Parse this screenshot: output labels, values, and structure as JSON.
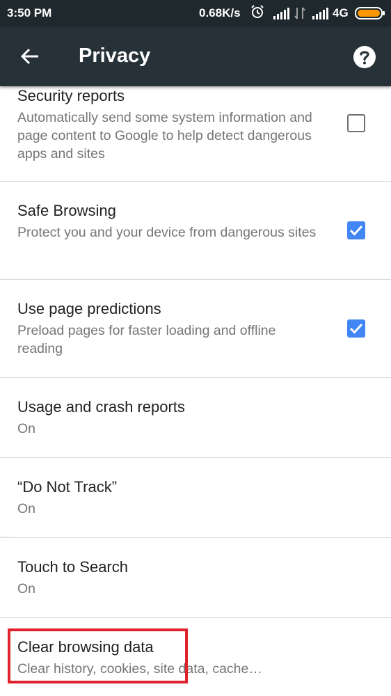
{
  "status_bar": {
    "time": "3:50 PM",
    "speed": "0.68K/s",
    "network": "4G",
    "icons": [
      "alarm-icon",
      "signal-icon",
      "data-transfer-icon",
      "signal-icon",
      "battery-icon"
    ],
    "battery_color": "#ff9800"
  },
  "app_bar": {
    "title": "Privacy",
    "back_icon": "arrow-back-icon",
    "help_icon": "help-circle-icon",
    "background": "#263238"
  },
  "settings": [
    {
      "title": "Security reports",
      "summary": "Automatically send some system information and page content to Google to help detect dangerous apps and sites",
      "checkbox": false
    },
    {
      "title": "Safe Browsing",
      "summary": "Protect you and your device from dangerous sites",
      "checkbox": true
    },
    {
      "title": "Use page predictions",
      "summary": "Preload pages for faster loading and offline reading",
      "checkbox": true
    },
    {
      "title": "Usage and crash reports",
      "summary": "On"
    },
    {
      "title": "“Do Not Track”",
      "summary": "On"
    },
    {
      "title": "Touch to Search",
      "summary": "On"
    },
    {
      "title": "Clear browsing data",
      "summary": "Clear history, cookies, site data, cache…",
      "highlighted": true
    }
  ],
  "colors": {
    "checkbox_on": "#4285f4",
    "highlight": "#e0232b",
    "status_bar": "#1f282c"
  }
}
